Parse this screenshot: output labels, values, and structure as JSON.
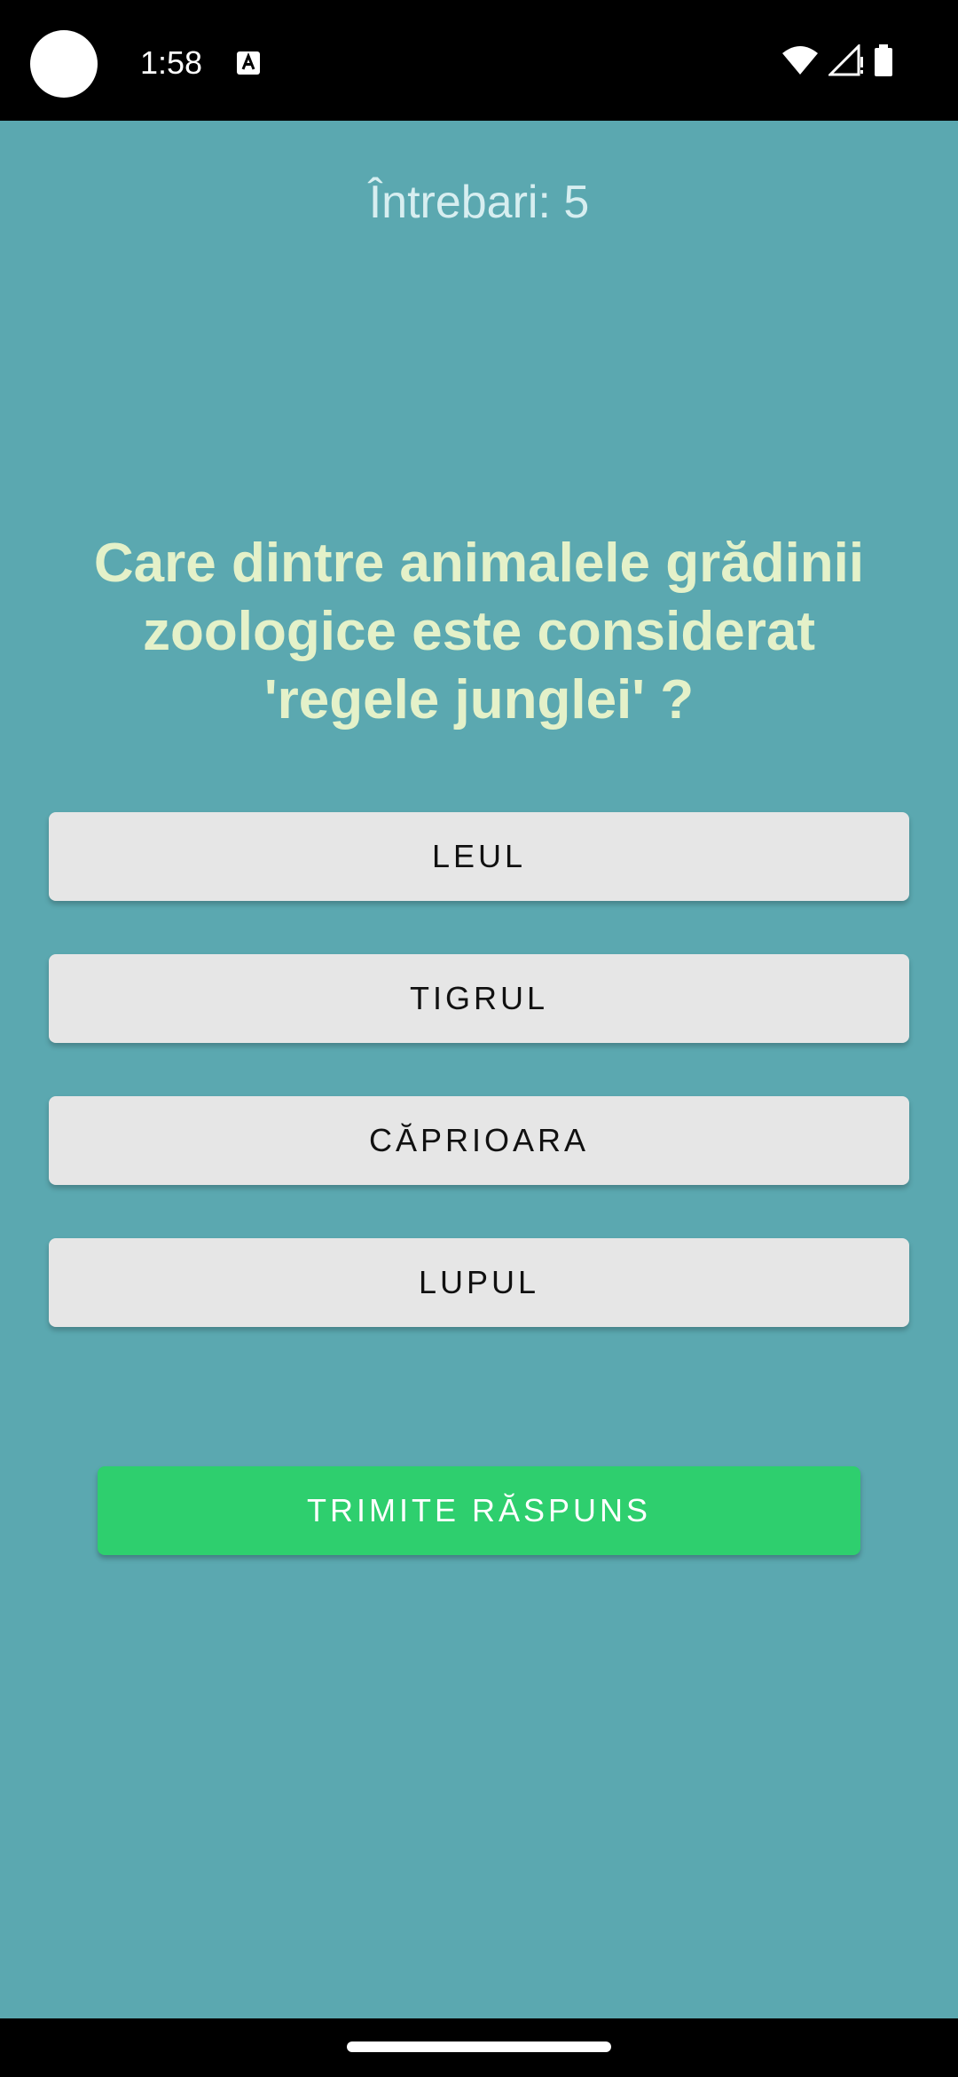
{
  "status_bar": {
    "time": "1:58",
    "icons": [
      "camera-cutout",
      "text-a-icon",
      "wifi-icon",
      "signal-icon",
      "battery-icon"
    ]
  },
  "quiz": {
    "questions_label": "Întrebari: 5",
    "question": "Care dintre animalele grădinii zoologice este considerat 'regele junglei' ?",
    "answers": [
      {
        "label": "LEUL"
      },
      {
        "label": "TIGRUL"
      },
      {
        "label": "CĂPRIOARA"
      },
      {
        "label": "LUPUL"
      }
    ],
    "submit_label": "TRIMITE RĂSPUNS"
  },
  "colors": {
    "background": "#5ba8b0",
    "question_text": "#e4f1c9",
    "answer_button": "#e6e6e6",
    "submit_button": "#2ecf6e"
  }
}
